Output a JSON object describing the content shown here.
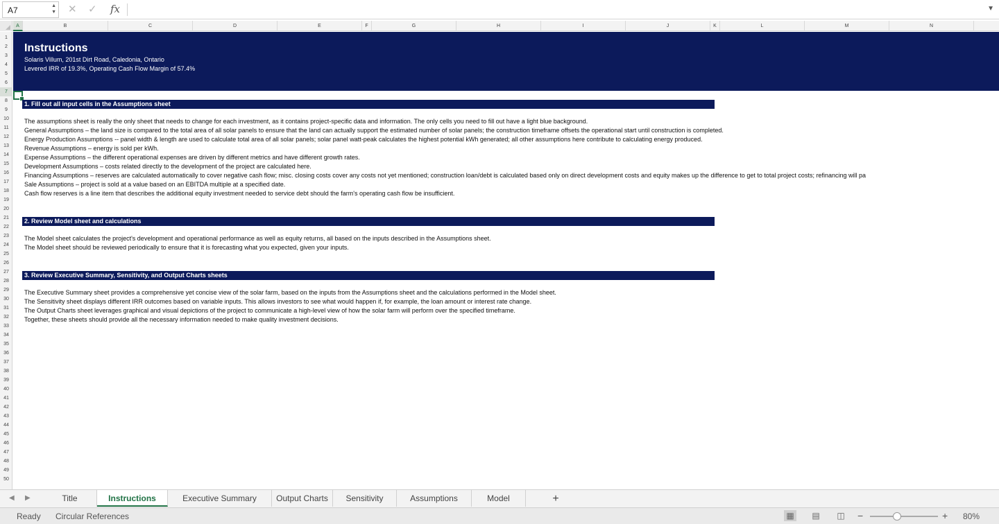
{
  "formula_bar": {
    "name_box": "A7",
    "formula": "",
    "icons": [
      "cancel-icon",
      "confirm-icon",
      "function-icon",
      "chevron-down-icon"
    ]
  },
  "columns": [
    "A",
    "B",
    "C",
    "D",
    "E",
    "F",
    "G",
    "H",
    "I",
    "J",
    "K",
    "L",
    "M",
    "N"
  ],
  "rows": [
    "1",
    "2",
    "3",
    "4",
    "5",
    "6",
    "7",
    "8",
    "9",
    "10",
    "11",
    "12",
    "13",
    "14",
    "15",
    "16",
    "17",
    "18",
    "19",
    "20",
    "21",
    "22",
    "23",
    "24",
    "25",
    "26",
    "27",
    "28",
    "29",
    "30",
    "31",
    "32",
    "33",
    "34",
    "35",
    "36",
    "37",
    "38",
    "39",
    "40",
    "41",
    "42",
    "43",
    "44",
    "45",
    "46",
    "47",
    "48",
    "49",
    "50"
  ],
  "active_cell": {
    "column": "A",
    "row": "7"
  },
  "header": {
    "title": "Instructions",
    "address": "Solaris Villum, 201st Dirt Road, Caledonia, Ontario",
    "metrics": "Levered IRR of 19.3%, Operating Cash Flow Margin of 57.4%"
  },
  "sections": [
    {
      "title": "1. Fill out all input cells in the Assumptions sheet",
      "lines": [
        "The assumptions sheet is really the only sheet that needs to change for each investment, as it contains project-specific data and information. The only cells you need to fill out have a light blue background.",
        "General Assumptions – the land size is compared to the total area of all solar panels to ensure that the land can actually support the estimated number of solar panels; the construction timeframe offsets the operational start until construction is completed.",
        "Energy Production Assumptions -- panel width & length are used to calculate total area of all solar panels; solar panel watt-peak calculates the highest potential kWh generated; all other assumptions here contribute to calculating energy produced.",
        "Revenue Assumptions – energy is sold per kWh.",
        "Expense Assumptions – the different operational expenses are driven by different metrics and have different growth rates.",
        "Development Assumptions – costs related directly to the development of the project are calculated here.",
        "Financing Assumptions – reserves are calculated automatically to cover negative cash flow; misc. closing costs cover any costs not yet mentioned; construction loan/debt is calculated based only on direct development costs and equity makes up the difference to get to total project costs; refinancing will pa",
        "Sale Assumptions – project is sold at a value based on an EBITDA multiple at a specified date.",
        "Cash flow reserves is a line item that describes the additional equity investment needed to service debt should the farm's operating cash flow be insufficient."
      ]
    },
    {
      "title": "2. Review Model sheet and calculations",
      "lines": [
        "The Model sheet calculates the project's development and operational performance as well as equity returns, all based on the inputs described in the Assumptions sheet.",
        "The Model sheet should be reviewed periodically to ensure that it is forecasting what you expected, given your inputs."
      ]
    },
    {
      "title": "3. Review Executive Summary, Sensitivity, and Output Charts sheets",
      "lines": [
        "The Executive Summary sheet provides a comprehensive yet concise view of the solar farm, based on the inputs from the Assumptions sheet and the calculations performed in the Model sheet.",
        "The Sensitivity sheet displays different IRR outcomes based on variable inputs. This allows investors to see what would happen if, for example, the loan amount or interest rate change.",
        "The Output Charts sheet leverages graphical and visual depictions of the project to communicate a high-level view of how the solar farm will perform over the specified timeframe.",
        "Together, these sheets should provide all the necessary information needed to make quality investment decisions."
      ]
    }
  ],
  "sheet_tabs": [
    "Title",
    "Instructions",
    "Executive Summary",
    "Output Charts",
    "Sensitivity",
    "Assumptions",
    "Model"
  ],
  "active_tab": "Instructions",
  "add_sheet_label": "+",
  "status_bar": {
    "ready": "Ready",
    "circular": "Circular References",
    "zoom_minus": "−",
    "zoom_plus": "+",
    "zoom_percent": 80,
    "zoom_label": "80%",
    "views": [
      "normal-view-icon",
      "page-layout-view-icon",
      "page-break-view-icon"
    ]
  },
  "colors": {
    "banner": "#0c1a5b",
    "accent": "#217346"
  }
}
